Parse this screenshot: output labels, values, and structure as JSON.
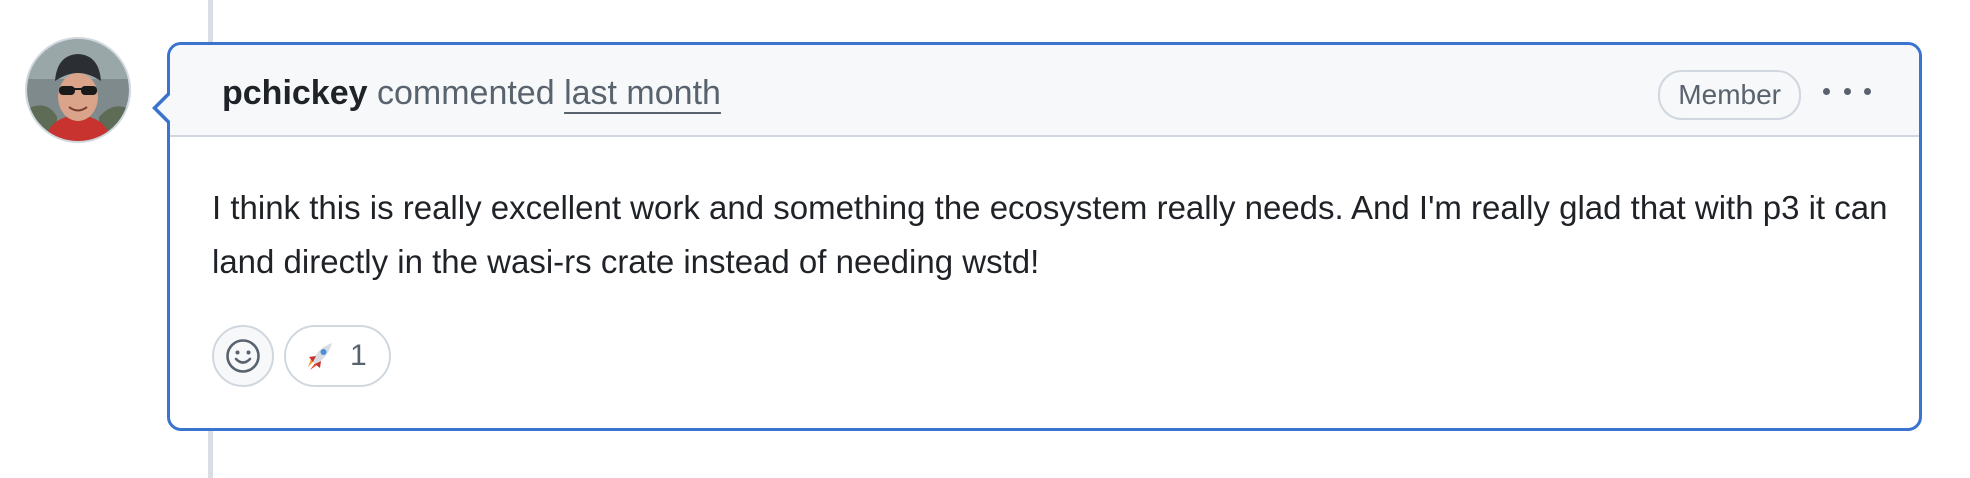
{
  "comment": {
    "author": "pchickey",
    "action": "commented",
    "timestamp": "last month",
    "role_badge": "Member",
    "body": "I think this is really excellent work and something the ecosystem really needs. And I'm really glad that with p3 it can land directly in the wasi-rs crate instead of needing wstd!",
    "reactions": [
      {
        "icon": "rocket-icon",
        "count": "1"
      }
    ],
    "add_reaction_icon": "smiley-icon",
    "menu_icon": "kebab-horizontal-icon"
  },
  "colors": {
    "focus_border": "#3a74cf",
    "header_bg": "#f6f8fa",
    "muted_text": "#59636e",
    "text": "#1f2328"
  }
}
